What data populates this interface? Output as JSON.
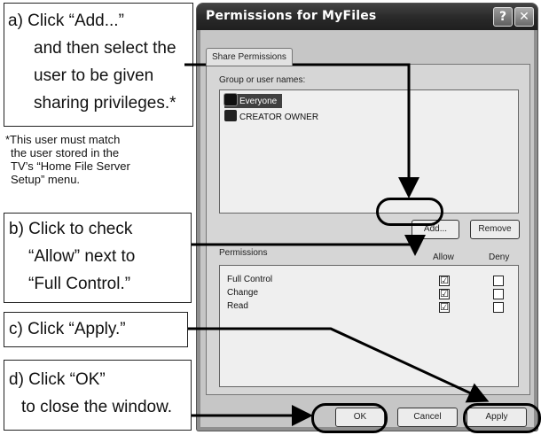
{
  "dialog": {
    "title": "Permissions for MyFiles",
    "help_button": "?",
    "close_button": "✕",
    "tab": "Share Permissions",
    "group_label": "Group or user names:",
    "groups": [
      "Everyone",
      "CREATOR OWNER"
    ],
    "add_button": "Add...",
    "remove_button": "Remove",
    "permissions_label": "Permissions",
    "allow_header": "Allow",
    "deny_header": "Deny",
    "permissions": [
      {
        "name": "Full Control",
        "allow": "☑",
        "deny": ""
      },
      {
        "name": "Change",
        "allow": "☑",
        "deny": ""
      },
      {
        "name": "Read",
        "allow": "☑",
        "deny": ""
      }
    ],
    "ok_button": "OK",
    "cancel_button": "Cancel",
    "apply_button": "Apply"
  },
  "callouts": {
    "a": [
      "a) Click “Add...”",
      "and then select the",
      "user to be given",
      "sharing privileges.*"
    ],
    "note": [
      "*This user must match",
      "the user stored in the",
      "TV’s “Home File Server",
      "Setup” menu."
    ],
    "b": [
      "b) Click to check",
      "“Allow” next to",
      "“Full Control.”"
    ],
    "c": "c) Click “Apply.”",
    "d": [
      "d) Click “OK”",
      "to close the window."
    ]
  }
}
